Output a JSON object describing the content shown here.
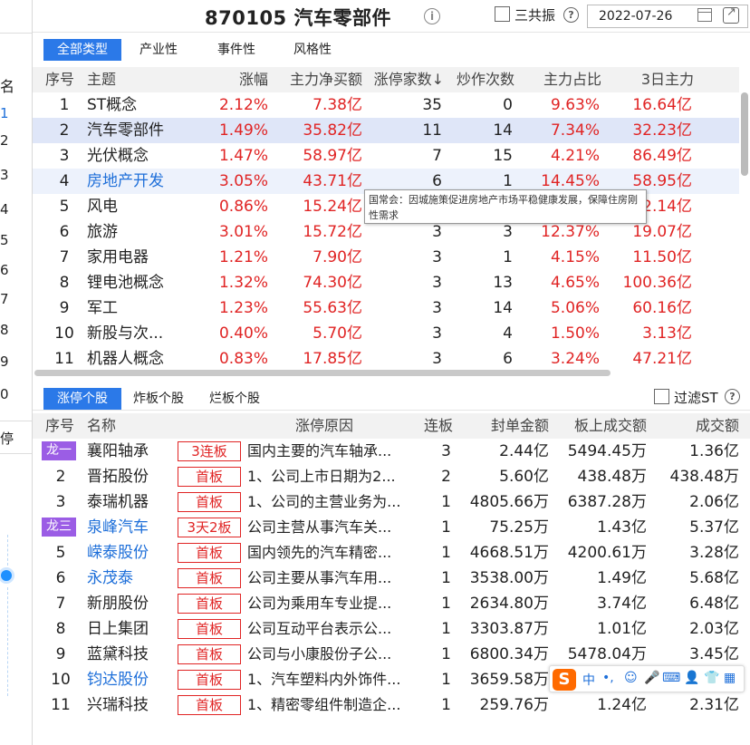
{
  "header": {
    "title": "870105 汽车零部件",
    "sangongzhen_label": "三共振",
    "date": "2022-07-26"
  },
  "left_panel": {
    "header": "名",
    "ranks": [
      "1",
      "2",
      "3",
      "4",
      "5",
      "6",
      "7",
      "8",
      "9",
      "0"
    ],
    "ting_label": "停"
  },
  "filter_tabs": [
    "全部类型",
    "产业性",
    "事件性",
    "风格性"
  ],
  "upper_table": {
    "columns": [
      "序号",
      "主题",
      "涨幅",
      "主力净买额",
      "涨停家数↓",
      "炒作次数",
      "主力占比",
      "3日主力"
    ],
    "rows": [
      {
        "idx": "1",
        "theme": "ST概念",
        "change": "2.12%",
        "net": "7.38亿",
        "limit": "35",
        "hype": "0",
        "ratio": "9.63%",
        "three": "16.64亿"
      },
      {
        "idx": "2",
        "theme": "汽车零部件",
        "change": "1.49%",
        "net": "35.82亿",
        "limit": "11",
        "hype": "14",
        "ratio": "7.34%",
        "three": "32.23亿"
      },
      {
        "idx": "3",
        "theme": "光伏概念",
        "change": "1.47%",
        "net": "58.97亿",
        "limit": "7",
        "hype": "15",
        "ratio": "4.21%",
        "three": "86.49亿"
      },
      {
        "idx": "4",
        "theme": "房地产开发",
        "change": "3.05%",
        "net": "43.71亿",
        "limit": "6",
        "hype": "1",
        "ratio": "14.45%",
        "three": "58.95亿"
      },
      {
        "idx": "5",
        "theme": "风电",
        "change": "0.86%",
        "net": "15.24亿",
        "limit": "",
        "hype": "",
        "ratio": "",
        "three": "2.14亿"
      },
      {
        "idx": "6",
        "theme": "旅游",
        "change": "3.01%",
        "net": "15.72亿",
        "limit": "3",
        "hype": "3",
        "ratio": "12.37%",
        "three": "19.07亿"
      },
      {
        "idx": "7",
        "theme": "家用电器",
        "change": "1.21%",
        "net": "7.90亿",
        "limit": "3",
        "hype": "1",
        "ratio": "4.15%",
        "three": "11.50亿"
      },
      {
        "idx": "8",
        "theme": "锂电池概念",
        "change": "1.32%",
        "net": "74.30亿",
        "limit": "3",
        "hype": "13",
        "ratio": "4.65%",
        "three": "100.36亿"
      },
      {
        "idx": "9",
        "theme": "军工",
        "change": "1.23%",
        "net": "55.63亿",
        "limit": "3",
        "hype": "14",
        "ratio": "5.06%",
        "three": "60.16亿"
      },
      {
        "idx": "10",
        "theme": "新股与次...",
        "change": "0.40%",
        "net": "5.70亿",
        "limit": "3",
        "hype": "4",
        "ratio": "1.50%",
        "three": "3.13亿"
      },
      {
        "idx": "11",
        "theme": "机器人概念",
        "change": "0.83%",
        "net": "17.85亿",
        "limit": "3",
        "hype": "6",
        "ratio": "3.24%",
        "three": "47.21亿"
      }
    ]
  },
  "tooltip": {
    "text": "国常会：因城施策促进房地产市场平稳健康发展，保障住房刚性需求"
  },
  "lower_tabs": [
    "涨停个股",
    "炸板个股",
    "烂板个股"
  ],
  "filter_st_label": "过滤ST",
  "lower_table": {
    "columns": [
      "序号",
      "名称",
      "涨停原因",
      "连板",
      "封单金额",
      "板上成交额",
      "成交额"
    ],
    "rows": [
      {
        "idx": "",
        "dragon": "龙一",
        "name": "襄阳轴承",
        "board": "3连板",
        "reason": "国内主要的汽车轴承...",
        "lian": "3",
        "seal": "2.44亿",
        "onboard": "5494.45万",
        "amount": "1.36亿",
        "blue": false
      },
      {
        "idx": "2",
        "dragon": "",
        "name": "晋拓股份",
        "board": "首板",
        "reason": "1、公司上市日期为2...",
        "lian": "2",
        "seal": "5.60亿",
        "onboard": "438.48万",
        "amount": "438.48万",
        "blue": false
      },
      {
        "idx": "3",
        "dragon": "",
        "name": "泰瑞机器",
        "board": "首板",
        "reason": "1、公司的主营业务为...",
        "lian": "1",
        "seal": "4805.66万",
        "onboard": "6387.28万",
        "amount": "2.06亿",
        "blue": false
      },
      {
        "idx": "",
        "dragon": "龙三",
        "name": "泉峰汽车",
        "board": "3天2板",
        "reason": "公司主营从事汽车关...",
        "lian": "1",
        "seal": "75.25万",
        "onboard": "1.43亿",
        "amount": "5.37亿",
        "blue": true
      },
      {
        "idx": "5",
        "dragon": "",
        "name": "嵘泰股份",
        "board": "首板",
        "reason": "国内领先的汽车精密...",
        "lian": "1",
        "seal": "4668.51万",
        "onboard": "4200.61万",
        "amount": "3.28亿",
        "blue": true
      },
      {
        "idx": "6",
        "dragon": "",
        "name": "永茂泰",
        "board": "首板",
        "reason": "公司主要从事汽车用...",
        "lian": "1",
        "seal": "3538.00万",
        "onboard": "1.49亿",
        "amount": "5.68亿",
        "blue": true
      },
      {
        "idx": "7",
        "dragon": "",
        "name": "新朋股份",
        "board": "首板",
        "reason": "公司为乘用车专业提...",
        "lian": "1",
        "seal": "2634.80万",
        "onboard": "3.74亿",
        "amount": "6.48亿",
        "blue": false
      },
      {
        "idx": "8",
        "dragon": "",
        "name": "日上集团",
        "board": "首板",
        "reason": "公司互动平台表示公...",
        "lian": "1",
        "seal": "3303.87万",
        "onboard": "1.01亿",
        "amount": "2.03亿",
        "blue": false
      },
      {
        "idx": "9",
        "dragon": "",
        "name": "蓝黛科技",
        "board": "首板",
        "reason": "公司与小康股份子公...",
        "lian": "1",
        "seal": "6800.34万",
        "onboard": "5478.04万",
        "amount": "3.45亿",
        "blue": false
      },
      {
        "idx": "10",
        "dragon": "",
        "name": "钧达股份",
        "board": "首板",
        "reason": "1、汽车塑料内外饰件...",
        "lian": "1",
        "seal": "3659.58万",
        "onboard": "",
        "amount": "",
        "blue": true
      },
      {
        "idx": "11",
        "dragon": "",
        "name": "兴瑞科技",
        "board": "首板",
        "reason": "1、精密零组件制造企...",
        "lian": "1",
        "seal": "259.76万",
        "onboard": "1.24亿",
        "amount": "2.31亿",
        "blue": false
      }
    ]
  },
  "ime": {
    "logo": "S",
    "zh": "中",
    "punct": "•,",
    "items": [
      "emoji-icon",
      "mic-icon",
      "keyboard-icon",
      "user-icon",
      "shirt-icon",
      "grid-icon"
    ]
  },
  "colors": {
    "accent_blue": "#2b79e8",
    "red": "#e02424",
    "link_blue": "#1e6fd9",
    "dragon_purple": "#9b5de5",
    "ime_orange": "#ff6a00"
  }
}
